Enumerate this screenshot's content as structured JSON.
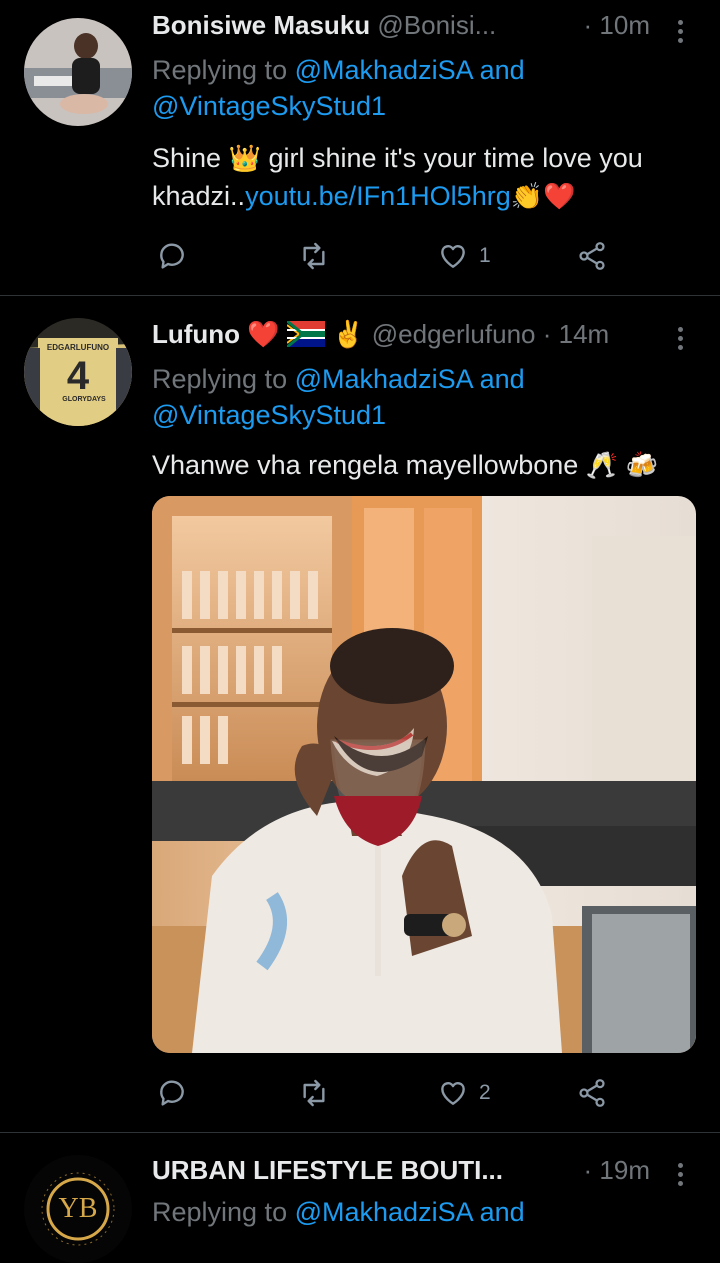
{
  "tweets": [
    {
      "display_name": "Bonisiwe Masuku",
      "handle": "@Bonisi...",
      "time": "· 10m",
      "replying_prefix": "Replying to",
      "reply_to_1": "@MakhadziSA",
      "reply_and": "and",
      "reply_to_2": "@VintageSkyStud1",
      "text_before_emoji": "Shine",
      "text_after_emoji": "girl shine it's your time love you",
      "text_line2_start": "khadzi..",
      "link": "youtu.be/IFn1HOl5hrg",
      "like_count": "1"
    },
    {
      "display_name": "Lufuno",
      "handle": "@edgerlufuno",
      "time": "· 14m",
      "replying_prefix": "Replying to",
      "reply_to_1": "@MakhadziSA",
      "reply_and": "and",
      "reply_to_2": "@VintageSkyStud1",
      "text": "Vhanwe vha rengela mayellowbone",
      "avatar_text_top": "EDGARLUFUNO",
      "avatar_number": "4",
      "avatar_text_bottom": "GLORYDAYS",
      "like_count": "2"
    },
    {
      "display_name": "URBAN LIFESTYLE BOUTI...",
      "time": "· 19m",
      "replying_prefix": "Replying to",
      "reply_to_1": "@MakhadziSA",
      "reply_and": "and",
      "avatar_monogram": "YB"
    }
  ],
  "colors": {
    "link": "#1d9bf0",
    "muted": "#71767b",
    "background": "#000000",
    "heart": "#e0245e"
  }
}
